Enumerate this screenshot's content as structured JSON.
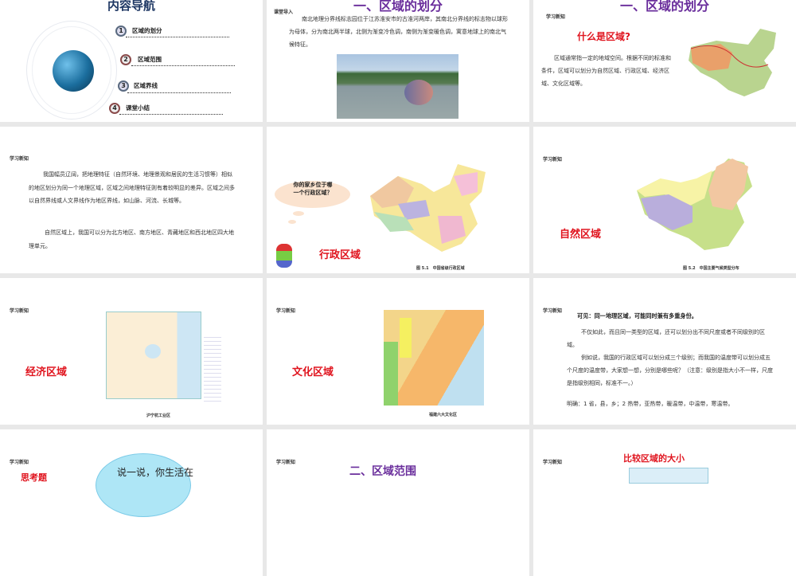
{
  "slides": [
    {
      "title": "内容导航",
      "items": [
        {
          "num": "1",
          "label": "区域的划分"
        },
        {
          "num": "2",
          "label": "区域范围"
        },
        {
          "num": "3",
          "label": "区域界线"
        },
        {
          "num": "4",
          "label": "课堂小结"
        }
      ]
    },
    {
      "title": "一、区域的划分",
      "tag": "课堂导入",
      "body": "南北地理分界线标志园位于江苏淮安市的古淮河两岸，其南北分界线的标志物以球形为母体，分为南北两半球，北侧为渐变冷色调，南侧为渐变暖色调，寓意地球上的南北气候特征。"
    },
    {
      "title": "一、区域的划分",
      "tag": "学习新知",
      "heading": "什么是区域?",
      "body": "区域通常指一定的地域空间。根据不同的标准和条件，区域可以划分为自然区域、行政区域、经济区域、文化区域等。"
    },
    {
      "tag": "学习新知",
      "p1": "我国幅员辽阔，把地理特征（自然环境、地理景观和居民的生活习惯等）相似的地区划分为同一个地理区域，区域之间地理特征则有着较明显的差异。区域之间多以自然界线或人文界线作为地区界线，如山脉、河流、长城等。",
      "p2": "自然区域上，我国可以分为北方地区、南方地区、青藏地区和西北地区四大地理单元。"
    },
    {
      "bubble": "你的家乡位于哪一个行政区域？",
      "label": "行政区域",
      "caption": "图 5.1　中国省级行政区域"
    },
    {
      "tag": "学习新知",
      "label": "自然区域",
      "caption": "图 5.2　中国主要气候类型分布"
    },
    {
      "tag": "学习新知",
      "label": "经济区域",
      "caption": "沪宁杭工业区"
    },
    {
      "tag": "学习新知",
      "label": "文化区域",
      "caption": "福建六大文化区"
    },
    {
      "tag": "学习新知",
      "heading": "可见：同一地理区域，可能同时兼有多重身份。",
      "p1": "不仅如此，而且同一类型的区域，还可以划分出不同尺度或者不同级别的区域。",
      "p2": "例如说，我国的行政区域可以划分成三个级别；而我国的温度带可以划分成五个尺度的温度带，大家想一想，分别是哪些呢？（注意：级别是指大小不一样，尺度是指级别相同，标准不一。）",
      "p3": "明确：1 省，县，乡；2 热带，亚热带，暖温带，中温带，寒温带。"
    },
    {
      "tag": "学习新知",
      "label": "思考题",
      "bubble": "说一说，你生活在"
    },
    {
      "tag": "学习新知",
      "title": "二、区域范围"
    },
    {
      "tag": "学习新知",
      "heading": "比较区域的大小"
    }
  ],
  "colors": {
    "purple": "#6a2e9c",
    "red": "#e0141e",
    "navy": "#1f3864"
  }
}
